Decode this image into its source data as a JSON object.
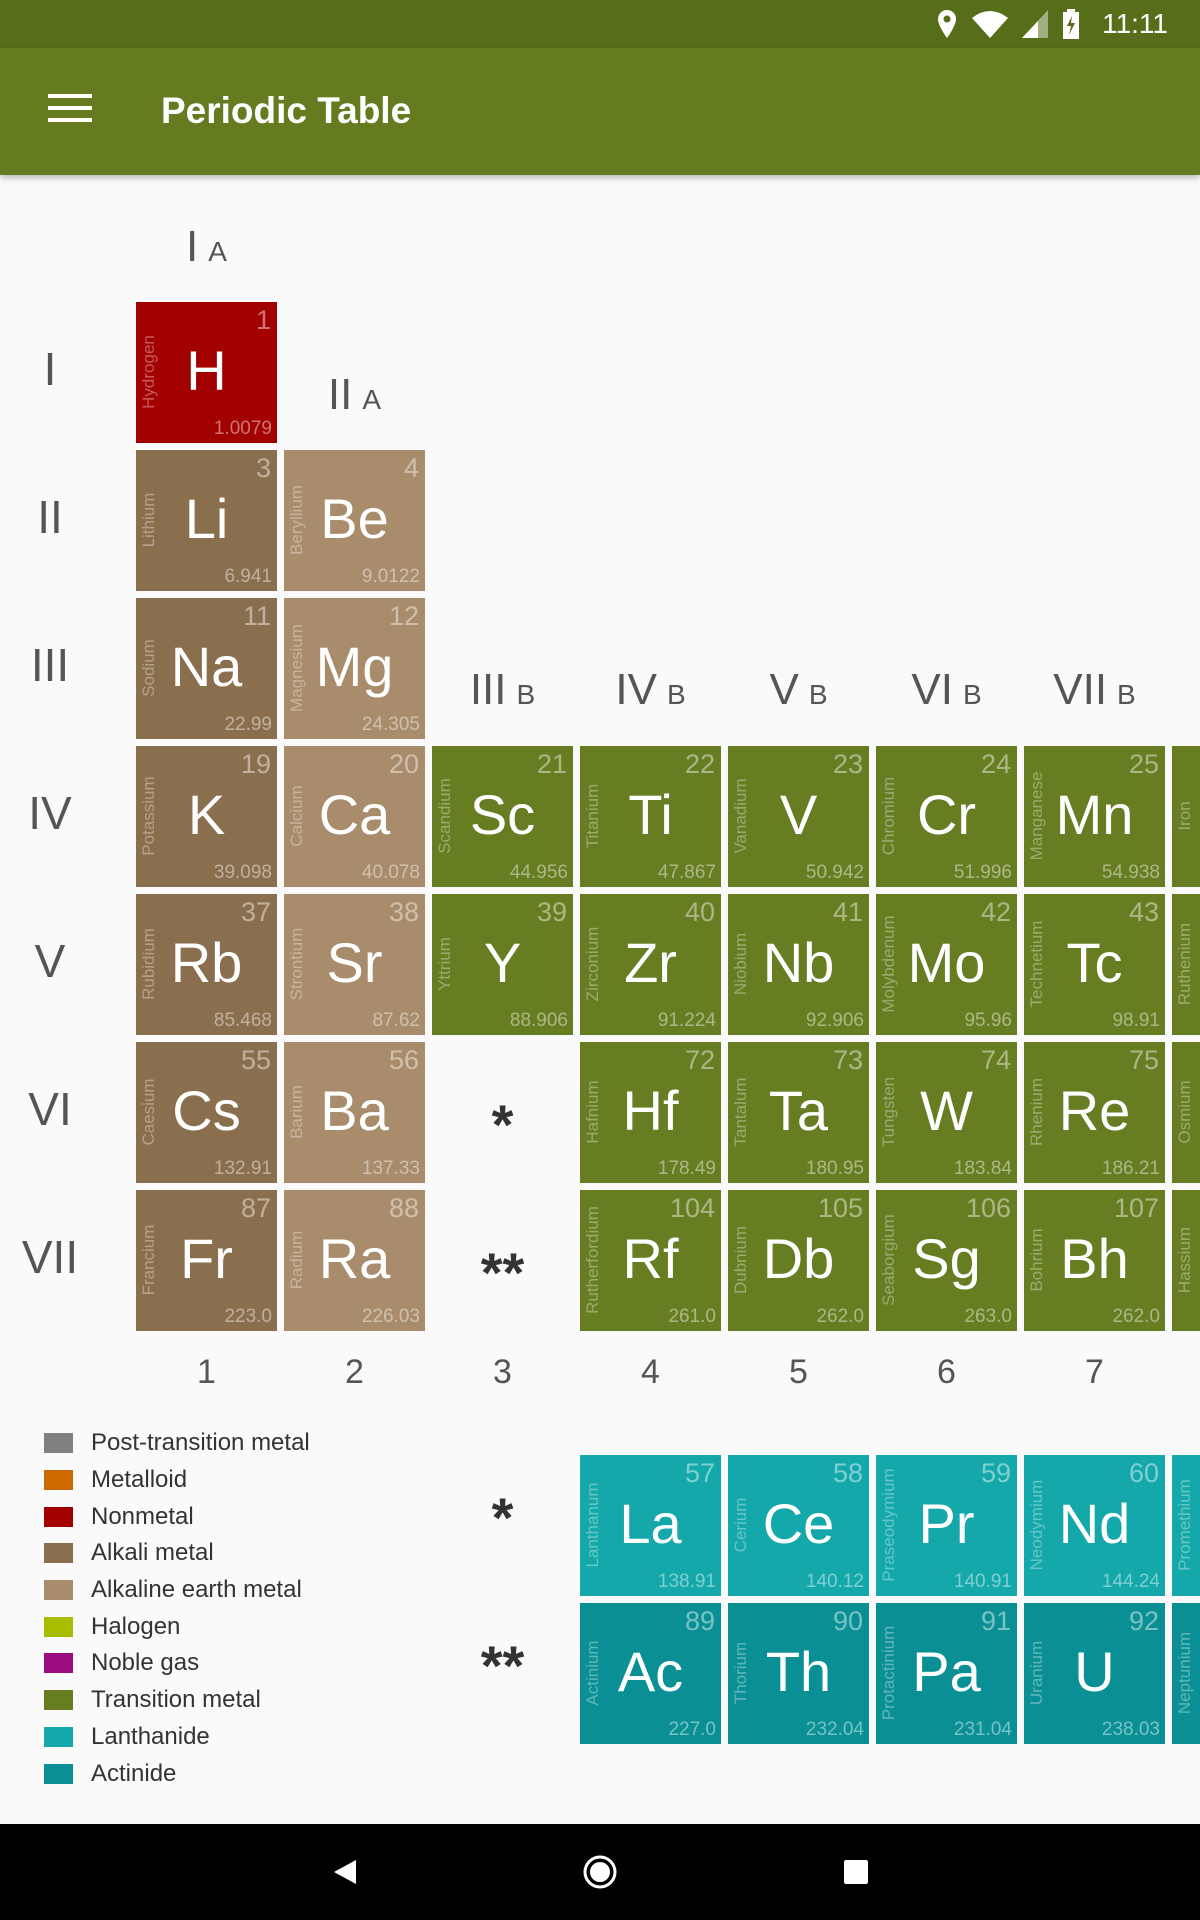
{
  "status_bar": {
    "time": "11:11",
    "icons": [
      "location-icon",
      "wifi-icon",
      "signal-icon",
      "battery-charging-icon"
    ]
  },
  "app_bar": {
    "title": "Periodic Table",
    "menu_icon": "hamburger-menu-icon"
  },
  "group_labels": [
    {
      "roman": "I",
      "sub": "A",
      "group": 1
    },
    {
      "roman": "II",
      "sub": "A",
      "group": 2
    },
    {
      "roman": "III",
      "sub": "B",
      "group": 3
    },
    {
      "roman": "IV",
      "sub": "B",
      "group": 4
    },
    {
      "roman": "V",
      "sub": "B",
      "group": 5
    },
    {
      "roman": "VI",
      "sub": "B",
      "group": 6
    },
    {
      "roman": "VII",
      "sub": "B",
      "group": 7
    }
  ],
  "period_labels": [
    "I",
    "II",
    "III",
    "IV",
    "V",
    "VI",
    "VII"
  ],
  "column_numbers": [
    "1",
    "2",
    "3",
    "4",
    "5",
    "6",
    "7"
  ],
  "markers": {
    "lanthanide": "*",
    "actinide": "**"
  },
  "categories": {
    "nonmetal": "#a30000",
    "alkali": "#8a6f4e",
    "alkaline": "#a88c6b",
    "transition": "#667d22",
    "lanthanide": "#14a8aa",
    "actinide": "#0a9094"
  },
  "elements": [
    {
      "symbol": "H",
      "name": "Hydrogen",
      "number": "1",
      "mass": "1.0079",
      "category": "nonmetal",
      "group": 1,
      "period": 1
    },
    {
      "symbol": "Li",
      "name": "Lithium",
      "number": "3",
      "mass": "6.941",
      "category": "alkali",
      "group": 1,
      "period": 2
    },
    {
      "symbol": "Be",
      "name": "Beryllium",
      "number": "4",
      "mass": "9.0122",
      "category": "alkaline",
      "group": 2,
      "period": 2
    },
    {
      "symbol": "Na",
      "name": "Sodium",
      "number": "11",
      "mass": "22.99",
      "category": "alkali",
      "group": 1,
      "period": 3
    },
    {
      "symbol": "Mg",
      "name": "Magnesium",
      "number": "12",
      "mass": "24.305",
      "category": "alkaline",
      "group": 2,
      "period": 3
    },
    {
      "symbol": "K",
      "name": "Potassium",
      "number": "19",
      "mass": "39.098",
      "category": "alkali",
      "group": 1,
      "period": 4
    },
    {
      "symbol": "Ca",
      "name": "Calcium",
      "number": "20",
      "mass": "40.078",
      "category": "alkaline",
      "group": 2,
      "period": 4
    },
    {
      "symbol": "Sc",
      "name": "Scandium",
      "number": "21",
      "mass": "44.956",
      "category": "transition",
      "group": 3,
      "period": 4
    },
    {
      "symbol": "Ti",
      "name": "Titanium",
      "number": "22",
      "mass": "47.867",
      "category": "transition",
      "group": 4,
      "period": 4
    },
    {
      "symbol": "V",
      "name": "Vanadium",
      "number": "23",
      "mass": "50.942",
      "category": "transition",
      "group": 5,
      "period": 4
    },
    {
      "symbol": "Cr",
      "name": "Chromium",
      "number": "24",
      "mass": "51.996",
      "category": "transition",
      "group": 6,
      "period": 4
    },
    {
      "symbol": "Mn",
      "name": "Manganese",
      "number": "25",
      "mass": "54.938",
      "category": "transition",
      "group": 7,
      "period": 4
    },
    {
      "symbol": "",
      "name": "Iron",
      "number": "",
      "mass": "",
      "category": "transition",
      "group": 8,
      "period": 4
    },
    {
      "symbol": "Rb",
      "name": "Rubidium",
      "number": "37",
      "mass": "85.468",
      "category": "alkali",
      "group": 1,
      "period": 5
    },
    {
      "symbol": "Sr",
      "name": "Strontium",
      "number": "38",
      "mass": "87.62",
      "category": "alkaline",
      "group": 2,
      "period": 5
    },
    {
      "symbol": "Y",
      "name": "Yttrium",
      "number": "39",
      "mass": "88.906",
      "category": "transition",
      "group": 3,
      "period": 5
    },
    {
      "symbol": "Zr",
      "name": "Zirconium",
      "number": "40",
      "mass": "91.224",
      "category": "transition",
      "group": 4,
      "period": 5
    },
    {
      "symbol": "Nb",
      "name": "Niobium",
      "number": "41",
      "mass": "92.906",
      "category": "transition",
      "group": 5,
      "period": 5
    },
    {
      "symbol": "Mo",
      "name": "Molybdenum",
      "number": "42",
      "mass": "95.96",
      "category": "transition",
      "group": 6,
      "period": 5
    },
    {
      "symbol": "Tc",
      "name": "Technetium",
      "number": "43",
      "mass": "98.91",
      "category": "transition",
      "group": 7,
      "period": 5
    },
    {
      "symbol": "",
      "name": "Ruthenium",
      "number": "",
      "mass": "",
      "category": "transition",
      "group": 8,
      "period": 5
    },
    {
      "symbol": "Cs",
      "name": "Caesium",
      "number": "55",
      "mass": "132.91",
      "category": "alkali",
      "group": 1,
      "period": 6
    },
    {
      "symbol": "Ba",
      "name": "Barium",
      "number": "56",
      "mass": "137.33",
      "category": "alkaline",
      "group": 2,
      "period": 6
    },
    {
      "symbol": "Hf",
      "name": "Hafnium",
      "number": "72",
      "mass": "178.49",
      "category": "transition",
      "group": 4,
      "period": 6
    },
    {
      "symbol": "Ta",
      "name": "Tantalum",
      "number": "73",
      "mass": "180.95",
      "category": "transition",
      "group": 5,
      "period": 6
    },
    {
      "symbol": "W",
      "name": "Tungsten",
      "number": "74",
      "mass": "183.84",
      "category": "transition",
      "group": 6,
      "period": 6
    },
    {
      "symbol": "Re",
      "name": "Rhenium",
      "number": "75",
      "mass": "186.21",
      "category": "transition",
      "group": 7,
      "period": 6
    },
    {
      "symbol": "",
      "name": "Osmium",
      "number": "",
      "mass": "",
      "category": "transition",
      "group": 8,
      "period": 6
    },
    {
      "symbol": "Fr",
      "name": "Francium",
      "number": "87",
      "mass": "223.0",
      "category": "alkali",
      "group": 1,
      "period": 7
    },
    {
      "symbol": "Ra",
      "name": "Radium",
      "number": "88",
      "mass": "226.03",
      "category": "alkaline",
      "group": 2,
      "period": 7
    },
    {
      "symbol": "Rf",
      "name": "Rutherfordium",
      "number": "104",
      "mass": "261.0",
      "category": "transition",
      "group": 4,
      "period": 7
    },
    {
      "symbol": "Db",
      "name": "Dubnium",
      "number": "105",
      "mass": "262.0",
      "category": "transition",
      "group": 5,
      "period": 7
    },
    {
      "symbol": "Sg",
      "name": "Seaborgium",
      "number": "106",
      "mass": "263.0",
      "category": "transition",
      "group": 6,
      "period": 7
    },
    {
      "symbol": "Bh",
      "name": "Bohrium",
      "number": "107",
      "mass": "262.0",
      "category": "transition",
      "group": 7,
      "period": 7
    },
    {
      "symbol": "",
      "name": "Hassium",
      "number": "",
      "mass": "",
      "category": "transition",
      "group": 8,
      "period": 7
    }
  ],
  "f_block": [
    {
      "symbol": "La",
      "name": "Lanthanum",
      "number": "57",
      "mass": "138.91",
      "category": "lanthanide",
      "series_index": 1,
      "series": "lanthanide"
    },
    {
      "symbol": "Ce",
      "name": "Cerium",
      "number": "58",
      "mass": "140.12",
      "category": "lanthanide",
      "series_index": 2,
      "series": "lanthanide"
    },
    {
      "symbol": "Pr",
      "name": "Praseodymium",
      "number": "59",
      "mass": "140.91",
      "category": "lanthanide",
      "series_index": 3,
      "series": "lanthanide"
    },
    {
      "symbol": "Nd",
      "name": "Neodymium",
      "number": "60",
      "mass": "144.24",
      "category": "lanthanide",
      "series_index": 4,
      "series": "lanthanide"
    },
    {
      "symbol": "",
      "name": "Promethium",
      "number": "",
      "mass": "",
      "category": "lanthanide",
      "series_index": 5,
      "series": "lanthanide"
    },
    {
      "symbol": "Ac",
      "name": "Actinium",
      "number": "89",
      "mass": "227.0",
      "category": "actinide",
      "series_index": 1,
      "series": "actinide"
    },
    {
      "symbol": "Th",
      "name": "Thorium",
      "number": "90",
      "mass": "232.04",
      "category": "actinide",
      "series_index": 2,
      "series": "actinide"
    },
    {
      "symbol": "Pa",
      "name": "Protactinium",
      "number": "91",
      "mass": "231.04",
      "category": "actinide",
      "series_index": 3,
      "series": "actinide"
    },
    {
      "symbol": "U",
      "name": "Uranium",
      "number": "92",
      "mass": "238.03",
      "category": "actinide",
      "series_index": 4,
      "series": "actinide"
    },
    {
      "symbol": "",
      "name": "Neptunium",
      "number": "",
      "mass": "",
      "category": "actinide",
      "series_index": 5,
      "series": "actinide"
    }
  ],
  "legend": [
    {
      "label": "Post-transition metal",
      "color": "#808080"
    },
    {
      "label": "Metalloid",
      "color": "#cc6a00"
    },
    {
      "label": "Nonmetal",
      "color": "#a30000"
    },
    {
      "label": "Alkali metal",
      "color": "#8a6f4e"
    },
    {
      "label": "Alkaline earth metal",
      "color": "#a88c6b"
    },
    {
      "label": "Halogen",
      "color": "#a9bd00"
    },
    {
      "label": "Noble gas",
      "color": "#9c0e80"
    },
    {
      "label": "Transition metal",
      "color": "#667d22"
    },
    {
      "label": "Lanthanide",
      "color": "#14a8aa"
    },
    {
      "label": "Actinide",
      "color": "#0a9094"
    }
  ],
  "nav_bar": {
    "icons": [
      "back-icon",
      "home-icon",
      "recents-icon"
    ]
  }
}
